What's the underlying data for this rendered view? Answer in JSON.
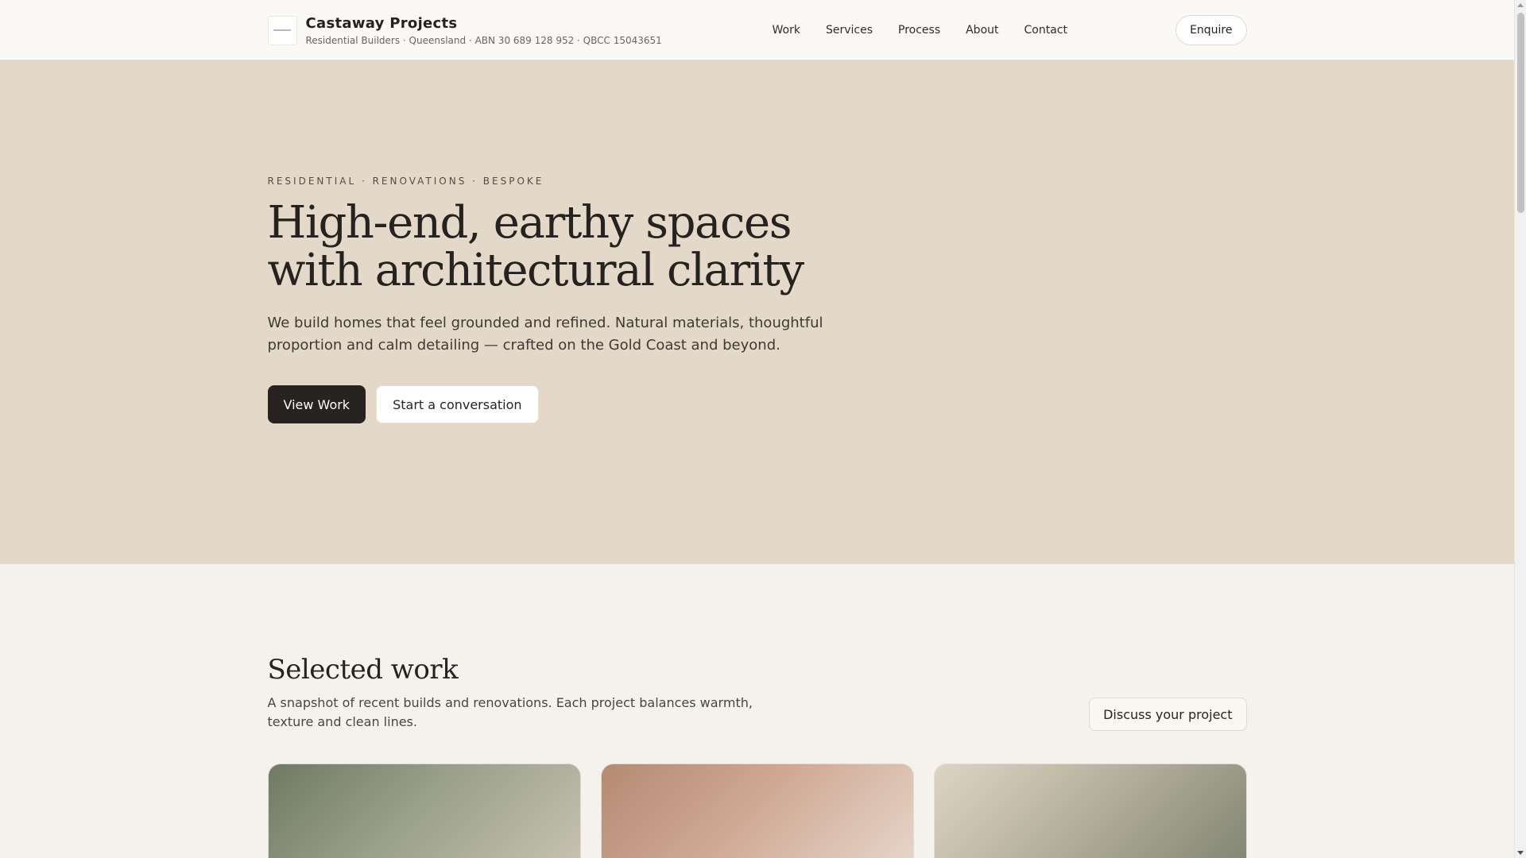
{
  "header": {
    "brand_name": "Castaway Projects",
    "brand_sub": "Residential Builders · Queensland · ABN 30 689 128 952 · QBCC 15043651",
    "nav": [
      "Work",
      "Services",
      "Process",
      "About",
      "Contact"
    ],
    "enquire_label": "Enquire"
  },
  "hero": {
    "eyebrow": "RESIDENTIAL · RENOVATIONS · BESPOKE",
    "title": "High-end, earthy spaces with architectural clarity",
    "text": "We build homes that feel grounded and refined. Natural materials, thoughtful proportion and calm detailing — crafted on the Gold Coast and beyond.",
    "primary_button": "View Work",
    "secondary_button": "Start a conversation"
  },
  "work": {
    "title": "Selected work",
    "text": "A snapshot of recent builds and renovations. Each project balances warmth, texture and clean lines.",
    "discuss_button": "Discuss your project"
  },
  "colors": {
    "hero_bg": "#e4d9c8",
    "page_bg": "#f5f1ec",
    "primary_button_bg": "#262320"
  }
}
